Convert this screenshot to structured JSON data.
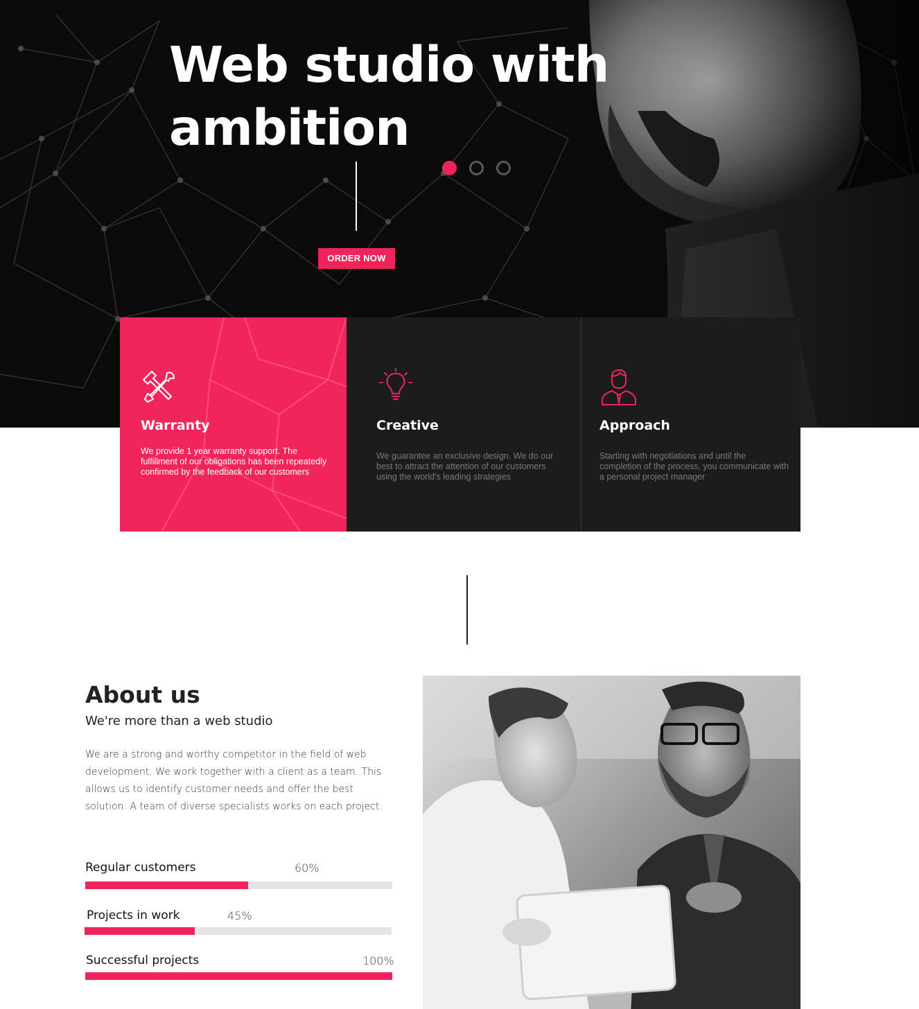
{
  "hero": {
    "title": "Web studio with ambition",
    "slides": [
      {
        "active": true
      },
      {
        "active": false
      },
      {
        "active": false
      }
    ],
    "cta_label": "ORDER NOW",
    "photo_icon": "bearded-man-portrait"
  },
  "features": [
    {
      "icon": "tools-icon",
      "title": "Warranty",
      "text": "We provide 1 year warranty support. The fulfillment of our obligations has been repeatedly confirmed by the feedback of our customers"
    },
    {
      "icon": "lightbulb-icon",
      "title": "Creative",
      "text": "We guarantee an exclusive design. We do our best to attract the attention of our customers using the world's leading strategies"
    },
    {
      "icon": "manager-icon",
      "title": "Approach",
      "text": "Starting with negotiations and until the completion of the process, you communicate with a personal project manager"
    }
  ],
  "about": {
    "title": "About us",
    "subtitle": "We're more than a web studio",
    "text": "We are a strong and worthy competitor in the field of web development. We work together with a client as a team. This  allows us to identify customer needs and offer the best solution. A team of diverse specialists works on each project.",
    "stats": [
      {
        "label": "Regular customers",
        "percent_label": "60%",
        "value": 0.53
      },
      {
        "label": "Projects in work",
        "percent_label": "45%",
        "value": 0.36
      },
      {
        "label": "Successful projects",
        "percent_label": "100%",
        "value": 1.0
      }
    ]
  },
  "colors": {
    "accent": "#f0245a",
    "dark": "#1c1c1d"
  }
}
